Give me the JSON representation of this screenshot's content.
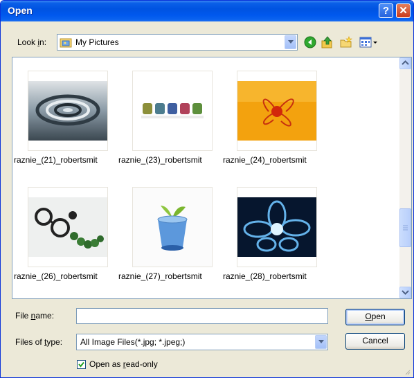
{
  "window": {
    "title": "Open"
  },
  "look_in": {
    "label_pre": "Look ",
    "label_u": "i",
    "label_post": "n:",
    "value": "My Pictures"
  },
  "toolbar": {
    "icons": [
      "back-icon",
      "up-folder-icon",
      "new-folder-icon",
      "views-menu-icon"
    ]
  },
  "files": [
    {
      "name": "raznie_(21)_robertsmit",
      "image": "water-ripple"
    },
    {
      "name": "raznie_(23)_robertsmit",
      "image": "colored-jars"
    },
    {
      "name": "raznie_(24)_robertsmit",
      "image": "orange-flower"
    },
    {
      "name": "raznie_(26)_robertsmit",
      "image": "glasses-caterpillar"
    },
    {
      "name": "raznie_(27)_robertsmit",
      "image": "blue-glass-plant"
    },
    {
      "name": "raznie_(28)_robertsmit",
      "image": "blue-light-flower"
    }
  ],
  "file_name": {
    "label_pre": "File ",
    "label_u": "n",
    "label_post": "ame:",
    "value": ""
  },
  "file_type": {
    "label_pre": "Files of ",
    "label_u": "t",
    "label_post": "ype:",
    "value": "All Image Files(*.jpg; *.jpeg;)"
  },
  "buttons": {
    "open_u": "O",
    "open_rest": "pen",
    "cancel": "Cancel"
  },
  "read_only": {
    "label_pre": "Open as ",
    "label_u": "r",
    "label_post": "ead-only",
    "checked": true
  }
}
